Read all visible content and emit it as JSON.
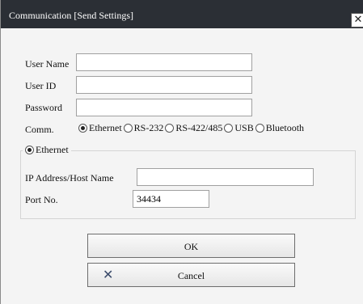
{
  "window": {
    "title": "Communication [Send Settings]",
    "close_glyph": "✕"
  },
  "form": {
    "user_name_label": "User Name",
    "user_name_value": "",
    "user_id_label": "User ID",
    "user_id_value": "",
    "password_label": "Password",
    "password_value": "",
    "comm_label": "Comm.",
    "comm_options": [
      {
        "label": "Ethernet",
        "selected": true
      },
      {
        "label": "RS-232",
        "selected": false
      },
      {
        "label": "RS-422/485",
        "selected": false
      },
      {
        "label": "USB",
        "selected": false
      },
      {
        "label": "Bluetooth",
        "selected": false
      }
    ]
  },
  "ethernet_group": {
    "title": "Ethernet",
    "ip_label": "IP Address/Host Name",
    "ip_value": "",
    "port_label": "Port No.",
    "port_value": "34434"
  },
  "buttons": {
    "ok_label": "OK",
    "cancel_label": "Cancel",
    "cancel_icon": "✕"
  }
}
